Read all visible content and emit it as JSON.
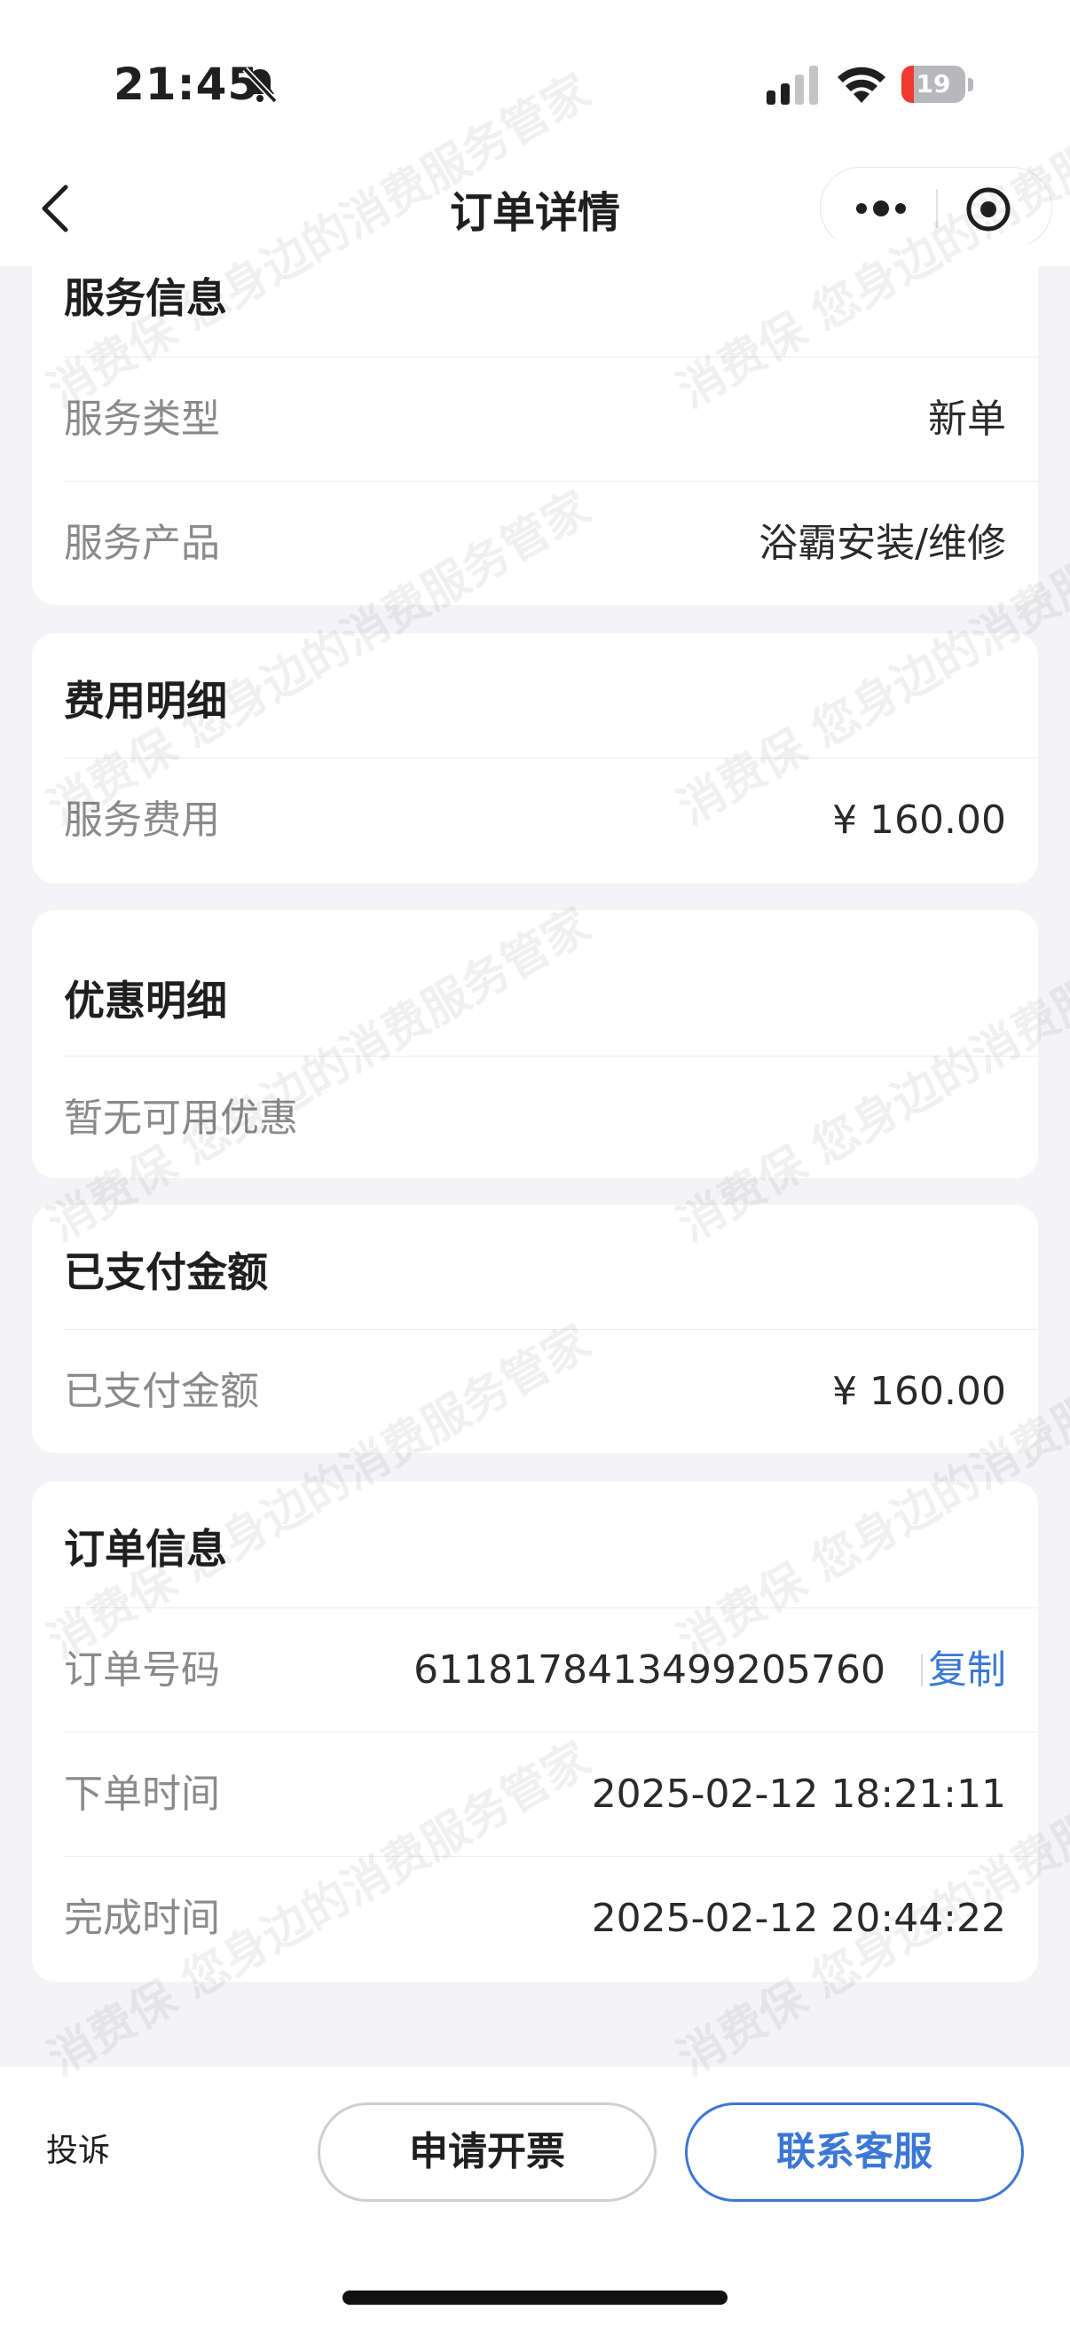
{
  "status_bar": {
    "time": "21:45",
    "battery_percent": 19,
    "battery_label": "19"
  },
  "nav": {
    "title": "订单详情"
  },
  "service_info": {
    "title": "服务信息",
    "rows": [
      {
        "label": "服务类型",
        "value": "新单"
      },
      {
        "label": "服务产品",
        "value": "浴霸安装/维修"
      }
    ]
  },
  "fee_detail": {
    "title": "费用明细",
    "rows": [
      {
        "label": "服务费用",
        "value": "¥ 160.00"
      }
    ]
  },
  "discount_detail": {
    "title": "优惠明细",
    "empty_text": "暂无可用优惠"
  },
  "paid_amount": {
    "title": "已支付金额",
    "rows": [
      {
        "label": "已支付金额",
        "value": "¥ 160.00"
      }
    ]
  },
  "order_info": {
    "title": "订单信息",
    "order_no_label": "订单号码",
    "order_no": "6118178413499205760",
    "copy_label": "复制",
    "order_time_label": "下单时间",
    "order_time": "2025-02-12 18:21:11",
    "finish_time_label": "完成时间",
    "finish_time": "2025-02-12 20:44:22"
  },
  "bottom_bar": {
    "complaint_label": "投诉",
    "invoice_label": "申请开票",
    "contact_label": "联系客服"
  },
  "watermark": {
    "text": "消费保 您身边的消费服务管家"
  },
  "colors": {
    "accent": "#3b78d6",
    "background": "#f4f4f6",
    "battery_low": "#ee3b30"
  }
}
